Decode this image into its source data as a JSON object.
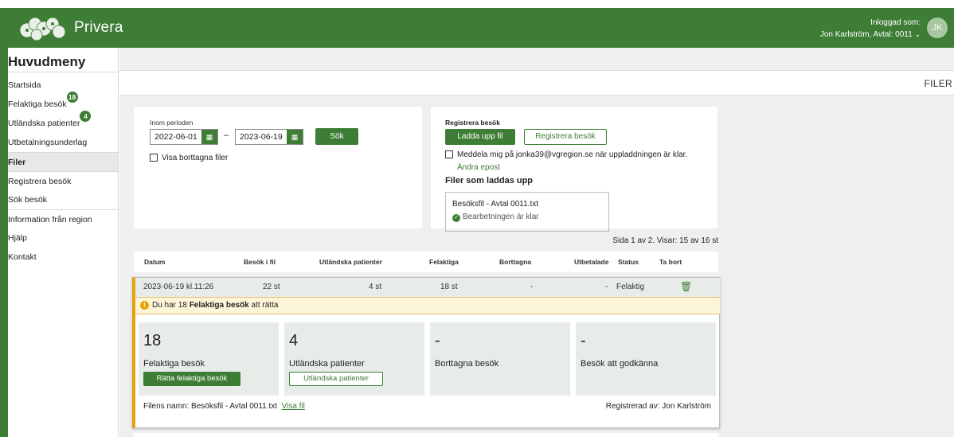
{
  "header": {
    "brand": "Privera",
    "logged_in_label": "Inloggad som:",
    "user_line": "Jon Karlström, Avtal: 0011",
    "avatar_initials": "JK",
    "bar_color": "#3e7d36"
  },
  "sidebar": {
    "title": "Huvudmeny",
    "items": [
      {
        "label": "Startsida"
      },
      {
        "label": "Felaktiga besök",
        "badge": "18"
      },
      {
        "label": "Utländska patienter",
        "badge": "4"
      },
      {
        "label": "Utbetalningsunderlag"
      },
      {
        "label": "Filer"
      },
      {
        "label": "Registrera besök"
      },
      {
        "label": "Sök besök"
      },
      {
        "label": "Information från region"
      },
      {
        "label": "Hjälp"
      },
      {
        "label": "Kontakt"
      }
    ]
  },
  "breadcrumb": "FILER",
  "search": {
    "period_label": "Inom perioden",
    "from_date": "2022-06-01",
    "to_date": "2023-06-19",
    "dash": "–",
    "search_button": "Sök",
    "show_deleted_label": "Visa borttagna filer"
  },
  "register": {
    "title": "Registrera besök",
    "upload_button": "Ladda upp fil",
    "register_button": "Registrera besök",
    "notify_label": "Meddela mig på jonka39@vgregion.se när uppladdningen är klar.",
    "change_email": "Ändra epost",
    "uploading_title": "Filer som laddas upp",
    "file_name": "Besöksfil - Avtal 0011.txt",
    "file_status": "Bearbetningen är klar"
  },
  "pagination": "Sida 1 av 2. Visar: 15 av 16 st",
  "table": {
    "headers": [
      "Datum",
      "Besök i fil",
      "Utländska patienter",
      "Felaktiga",
      "Borttagna",
      "Utbetalade",
      "Status",
      "Ta bort"
    ],
    "row": {
      "datum": "2023-06-19 kl.11:26",
      "besok": "22 st",
      "utlandska": "4 st",
      "felaktiga": "18 st",
      "borttagna": "-",
      "utbetalade": "-",
      "status": "Felaktig"
    }
  },
  "detail": {
    "warning_prefix": "Du har 18 ",
    "warning_bold": "Felaktiga besök",
    "warning_suffix": " att rätta",
    "stats": [
      {
        "value": "18",
        "caption": "Felaktiga besök",
        "button": "Rätta felaktiga besök"
      },
      {
        "value": "4",
        "caption": "Utländska patienter",
        "button": "Utländska patienter"
      },
      {
        "value": "-",
        "caption": "Borttagna besök"
      },
      {
        "value": "-",
        "caption": "Besök att godkänna"
      }
    ],
    "file_name_label": "Filens namn: Besöksfil - Avtal 0011.txt",
    "show_file": "Visa fil",
    "registered_by": "Registrerad av: Jon Karlström"
  }
}
